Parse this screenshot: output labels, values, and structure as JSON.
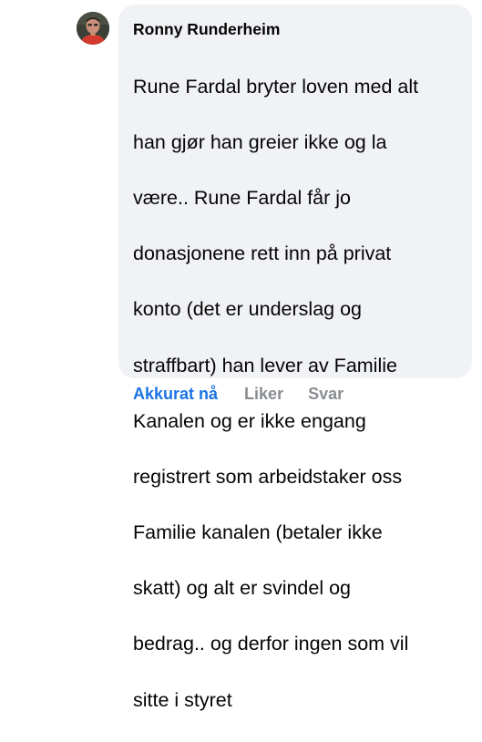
{
  "comment": {
    "author": "Ronny Runderheim",
    "text_lines": [
      "Rune Fardal bryter loven med alt",
      "han gjør han greier ikke og la",
      "være.. Rune Fardal får jo",
      "donasjonene rett inn på privat",
      "konto (det er underslag og",
      "straffbart) han lever av Familie",
      "Kanalen og er ikke engang",
      "registrert som arbeidstaker oss",
      "Familie kanalen (betaler ikke",
      "skatt) og alt er svindel og",
      "bedrag.. og derfor ingen som vil",
      "sitte i styret"
    ],
    "avatar_icon": "profile-photo"
  },
  "actions": {
    "timestamp": "Akkurat nå",
    "like_label": "Liker",
    "reply_label": "Svar"
  },
  "colors": {
    "bubble": "#f0f2f5",
    "text": "#050505",
    "link_blue": "#1b74e4",
    "muted": "#8a8d91"
  }
}
